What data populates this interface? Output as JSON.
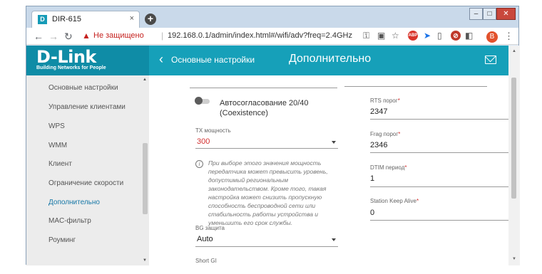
{
  "browser": {
    "tab_title": "DIR-615",
    "tab_close": "×",
    "favicon_letter": "D",
    "new_tab": "+",
    "not_secure_label": "Не защищено",
    "separator": "|",
    "url": "192.168.0.1/admin/index.html#/wifi/adv?freq=2.4GHz",
    "profile_initial": "B",
    "ext_abp": "ABP",
    "window_minimize": "–",
    "window_maximize": "□",
    "window_close": "✕"
  },
  "header": {
    "logo": "D-Link",
    "logo_tagline": "Building Networks for People",
    "back_label": "Основные настройки",
    "title": "Дополнительно"
  },
  "sidebar": {
    "items": [
      {
        "label": "Основные настройки"
      },
      {
        "label": "Управление клиентами"
      },
      {
        "label": "WPS"
      },
      {
        "label": "WMM"
      },
      {
        "label": "Клиент"
      },
      {
        "label": "Ограничение скорости"
      },
      {
        "label": "Дополнительно"
      },
      {
        "label": "MAC-фильтр"
      },
      {
        "label": "Роуминг"
      }
    ],
    "active_index": 6
  },
  "form": {
    "coexistence_label": "Автосогласование 20/40 (Coexistence)",
    "tx_power": {
      "label": "TX мощность",
      "value": "300"
    },
    "info_text": "При выборе этого значения мощность передатчика может превысить уровень, допустимый региональным законодательством. Кроме того, такая настройка может снизить пропускную способность беспроводной сети или стабильность работы устройства и уменьшить его срок службы.",
    "bg_protection": {
      "label": "BG защита",
      "value": "Auto"
    },
    "short_gi": {
      "label": "Short GI"
    },
    "rts": {
      "label": "RTS порог",
      "required": "*",
      "value": "2347"
    },
    "frag": {
      "label": "Frag порог",
      "required": "*",
      "value": "2346"
    },
    "dtim": {
      "label": "DTIM период",
      "required": "*",
      "value": "1"
    },
    "keep_alive": {
      "label": "Station Keep Alive",
      "required": "*",
      "value": "0"
    }
  },
  "colors": {
    "brand": "#16a0b9",
    "brand_dark": "#0f8ca6",
    "active_nav": "#1677a6",
    "warning": "#d32f2f"
  }
}
